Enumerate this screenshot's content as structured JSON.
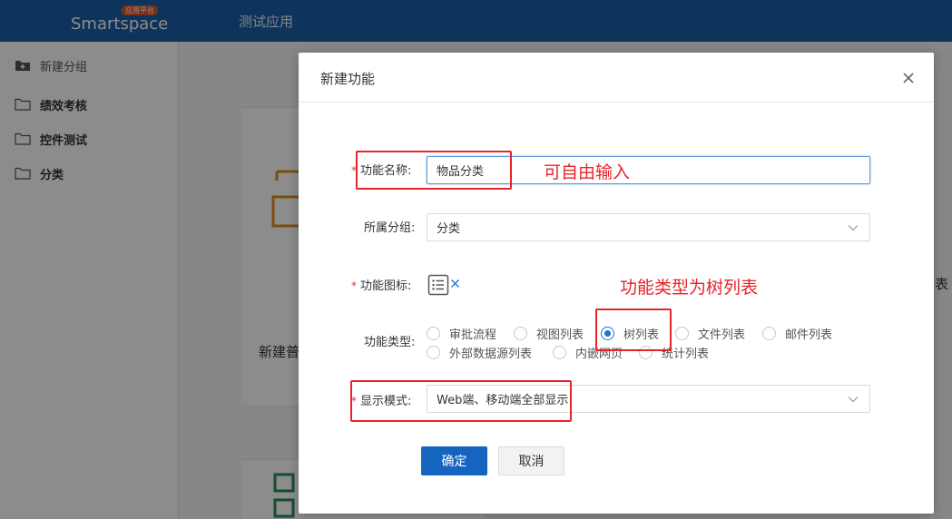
{
  "header": {
    "logo_text": "Smartspace",
    "logo_badge": "应用平台",
    "app_title": "测试应用"
  },
  "sidebar": {
    "new_group_label": "新建分组",
    "items": [
      {
        "label": "绩效考核"
      },
      {
        "label": "控件测试"
      },
      {
        "label": "分类"
      }
    ]
  },
  "background": {
    "card_label_left": "新建普",
    "card_label_right": "表"
  },
  "modal": {
    "title": "新建功能",
    "fields": {
      "name": {
        "label": "功能名称:",
        "value": "物品分类"
      },
      "group": {
        "label": "所属分组:",
        "value": "分类"
      },
      "icon": {
        "label": "功能图标:"
      },
      "type": {
        "label": "功能类型:",
        "options": [
          "审批流程",
          "视图列表",
          "树列表",
          "文件列表",
          "邮件列表",
          "外部数据源列表",
          "内嵌网页",
          "统计列表"
        ],
        "selected": "树列表"
      },
      "display": {
        "label": "显示模式:",
        "value": "Web端、移动端全部显示"
      }
    },
    "buttons": {
      "confirm": "确定",
      "cancel": "取消"
    }
  },
  "annotations": {
    "name_note": "可自由输入",
    "type_note": "功能类型为树列表"
  },
  "colors": {
    "header_bg": "#1d5fa7",
    "primary": "#1565c0",
    "annotation": "#e8232b",
    "required": "#e23b3b"
  }
}
